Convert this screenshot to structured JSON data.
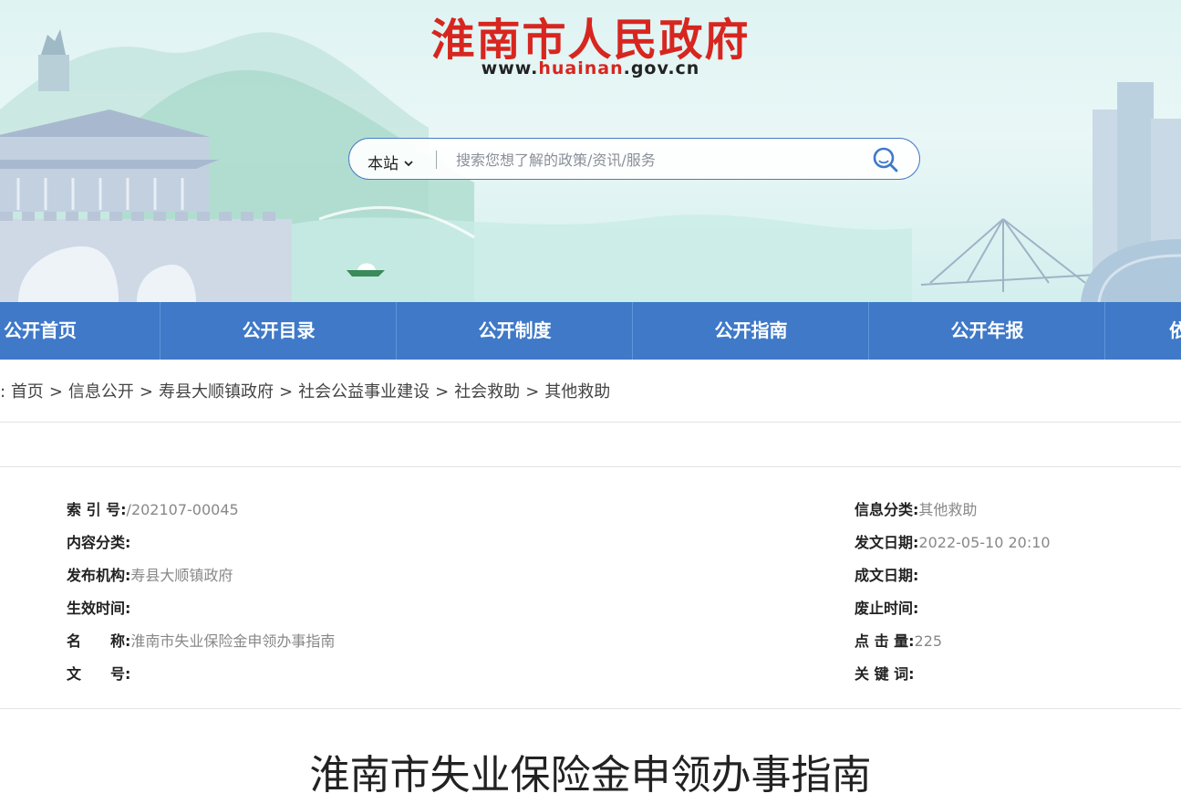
{
  "header": {
    "site_title": "淮南市人民政府",
    "url_prefix": "www.",
    "url_highlight": "huainan",
    "url_suffix": ".gov.cn"
  },
  "search": {
    "scope": "本站",
    "placeholder": "搜索您想了解的政策/资讯/服务",
    "icon": "search-icon"
  },
  "nav": {
    "items": [
      "公开首页",
      "公开目录",
      "公开制度",
      "公开指南",
      "公开年报",
      "依"
    ]
  },
  "breadcrumb": {
    "lead": ":",
    "items": [
      "首页",
      "信息公开",
      "寿县大顺镇政府",
      "社会公益事业建设",
      "社会救助",
      "其他救助"
    ],
    "separator": ">"
  },
  "meta": {
    "left": [
      {
        "label": "索 引 号:",
        "value": "/202107-00045"
      },
      {
        "label": "内容分类:",
        "value": ""
      },
      {
        "label": "发布机构:",
        "value": "寿县大顺镇政府"
      },
      {
        "label": "生效时间:",
        "value": ""
      },
      {
        "label": "名　　称:",
        "value": "淮南市失业保险金申领办事指南"
      },
      {
        "label": "文　　号:",
        "value": ""
      }
    ],
    "right": [
      {
        "label": "信息分类:",
        "value": "其他救助"
      },
      {
        "label": "发文日期:",
        "value": "2022-05-10 20:10"
      },
      {
        "label": "成文日期:",
        "value": ""
      },
      {
        "label": "废止时间:",
        "value": ""
      },
      {
        "label": "点 击 量:",
        "value": "225"
      },
      {
        "label": "关 键 词:",
        "value": ""
      }
    ]
  },
  "article": {
    "title": "淮南市失业保险金申领办事指南"
  },
  "colors": {
    "brand_red": "#d7261f",
    "nav_blue": "#3f79c8"
  }
}
